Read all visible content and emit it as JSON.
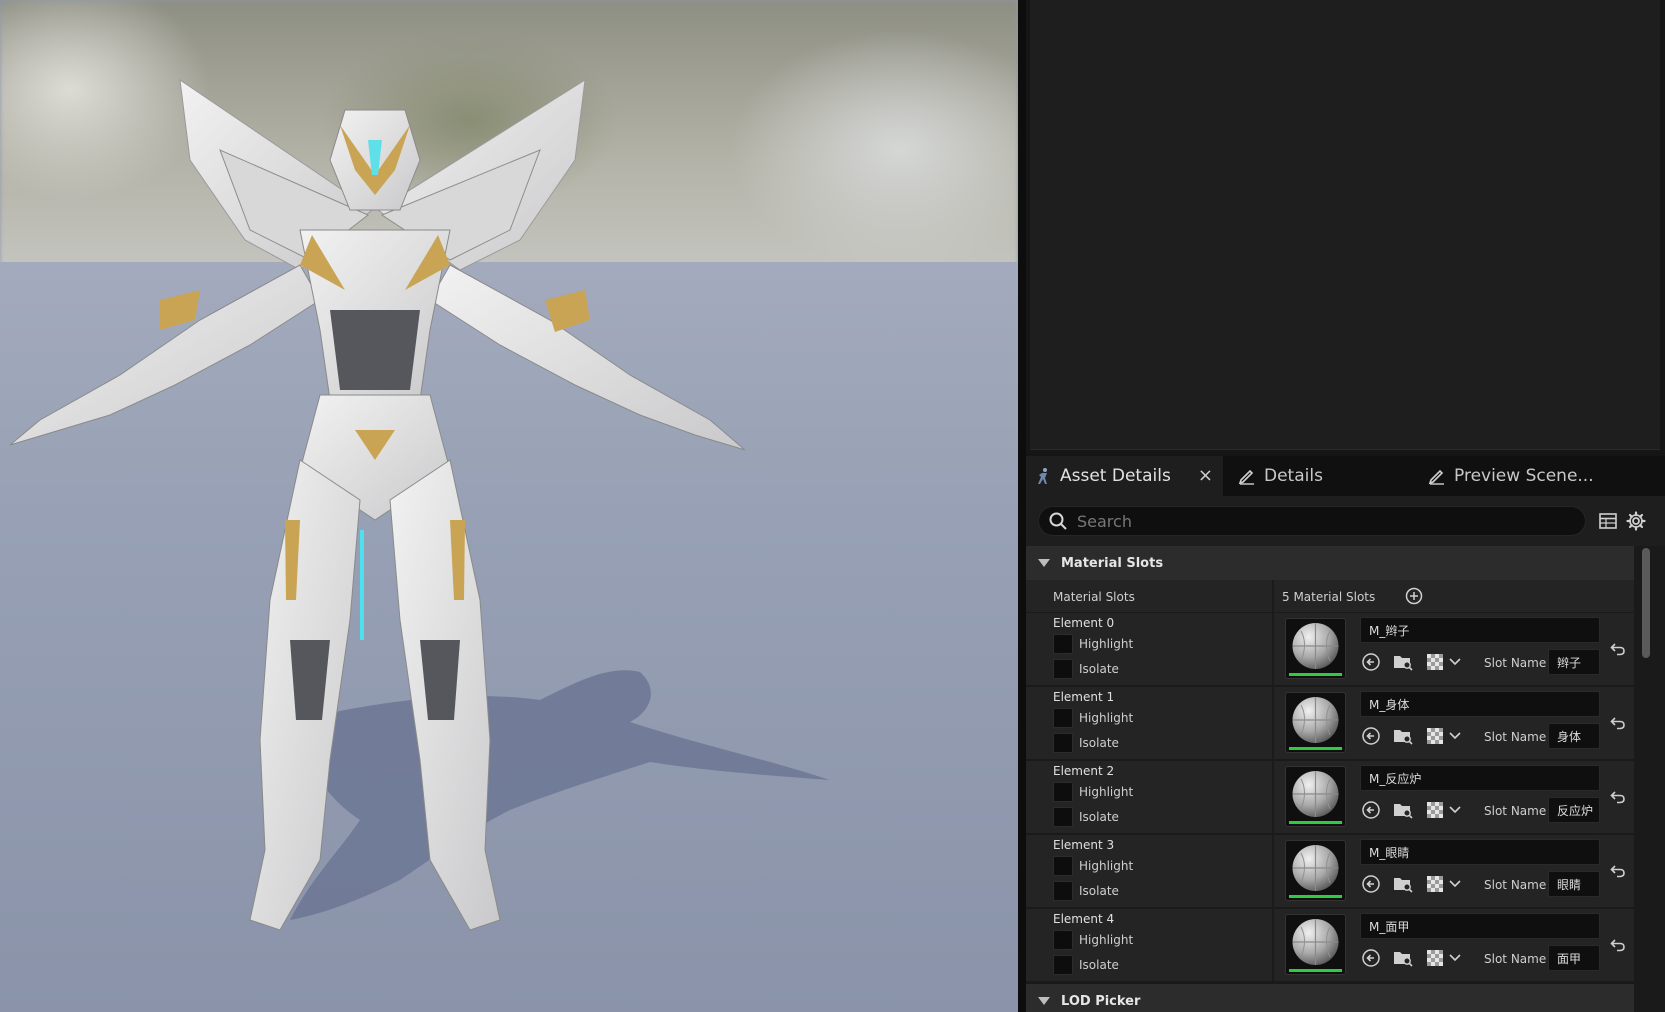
{
  "tabs": {
    "asset_details": "Asset Details",
    "details": "Details",
    "preview_scene": "Preview Scene...",
    "close_glyph": "×"
  },
  "search": {
    "placeholder": "Search",
    "value": ""
  },
  "material_slots": {
    "section_title": "Material Slots",
    "header_label": "Material Slots",
    "count_label": "5 Material Slots",
    "highlight_label": "Highlight",
    "isolate_label": "Isolate",
    "slot_name_label": "Slot Name",
    "elements": [
      {
        "name": "Element 0",
        "material": "M_辫子",
        "slot_name": "辫子",
        "highlight": false,
        "isolate": false
      },
      {
        "name": "Element 1",
        "material": "M_身体",
        "slot_name": "身体",
        "highlight": false,
        "isolate": false
      },
      {
        "name": "Element 2",
        "material": "M_反应炉",
        "slot_name": "反应炉",
        "highlight": false,
        "isolate": false
      },
      {
        "name": "Element 3",
        "material": "M_眼睛",
        "slot_name": "眼睛",
        "highlight": false,
        "isolate": false
      },
      {
        "name": "Element 4",
        "material": "M_面甲",
        "slot_name": "面甲",
        "highlight": false,
        "isolate": false
      }
    ]
  },
  "lod_picker": {
    "section_title": "LOD Picker"
  },
  "colors": {
    "accent_green": "#2ecc40",
    "panel_bg": "#1a1a1a",
    "row_bg": "#242424",
    "header_bg": "#2c2c2c"
  },
  "icons": {
    "asset_details": "mannequin-icon",
    "details": "pencil-icon",
    "preview_scene": "pencil-icon",
    "search": "search-icon",
    "table_view": "table-icon",
    "settings": "gear-icon",
    "add_slot": "plus-circle-icon",
    "use_selected": "arrow-left-circle-icon",
    "browse": "folder-search-icon",
    "material_picker": "checker-icon",
    "dropdown": "chevron-down-icon",
    "reset": "reset-arrow-icon"
  }
}
